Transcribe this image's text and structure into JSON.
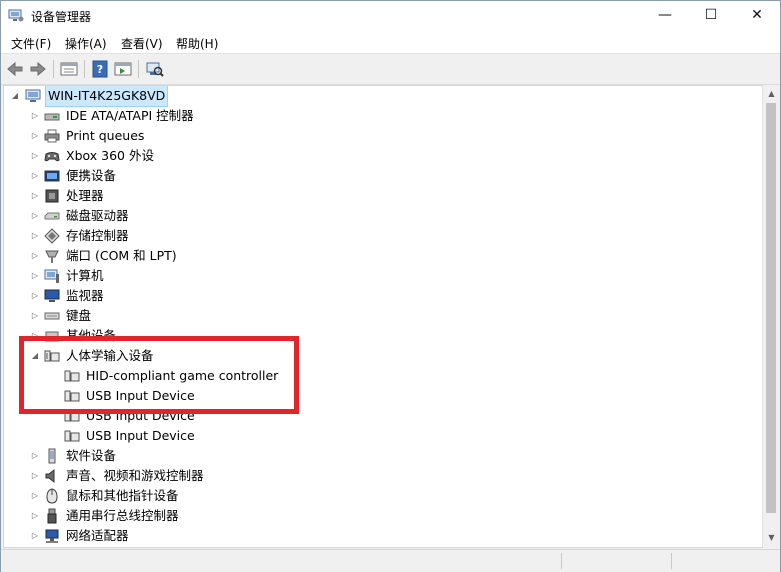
{
  "window": {
    "title": "设备管理器",
    "min_symbol": "—",
    "max_symbol": "☐",
    "close_symbol": "✕"
  },
  "menu": [
    "文件(F)",
    "操作(A)",
    "查看(V)",
    "帮助(H)"
  ],
  "toolbar": [
    "back-icon",
    "forward-icon",
    "properties-icon",
    "help-icon",
    "view-icon",
    "scan-hardware-icon"
  ],
  "tree": {
    "root": "WIN-IT4K25GK8VD",
    "categories": [
      {
        "label": "IDE ATA/ATAPI 控制器",
        "icon": "ide-controller-icon"
      },
      {
        "label": "Print queues",
        "icon": "printer-icon"
      },
      {
        "label": "Xbox 360 外设",
        "icon": "gamepad-icon"
      },
      {
        "label": "便携设备",
        "icon": "portable-device-icon"
      },
      {
        "label": "处理器",
        "icon": "processor-icon"
      },
      {
        "label": "磁盘驱动器",
        "icon": "disk-drive-icon"
      },
      {
        "label": "存储控制器",
        "icon": "storage-controller-icon"
      },
      {
        "label": "端口 (COM 和 LPT)",
        "icon": "port-icon"
      },
      {
        "label": "计算机",
        "icon": "computer-icon"
      },
      {
        "label": "监视器",
        "icon": "monitor-icon"
      },
      {
        "label": "键盘",
        "icon": "keyboard-icon"
      },
      {
        "label": "其他设备",
        "icon": "other-device-icon"
      },
      {
        "label": "人体学输入设备",
        "icon": "hid-icon",
        "expanded": true,
        "children": [
          "HID-compliant game controller",
          "USB Input Device",
          "USB Input Device",
          "USB Input Device"
        ]
      },
      {
        "label": "软件设备",
        "icon": "software-device-icon"
      },
      {
        "label": "声音、视频和游戏控制器",
        "icon": "sound-icon"
      },
      {
        "label": "鼠标和其他指针设备",
        "icon": "mouse-icon"
      },
      {
        "label": "通用串行总线控制器",
        "icon": "usb-icon"
      },
      {
        "label": "网络适配器",
        "icon": "network-adapter-icon"
      }
    ]
  },
  "colors": {
    "annotation": "#e0262b",
    "selection": "#cce8ff"
  }
}
